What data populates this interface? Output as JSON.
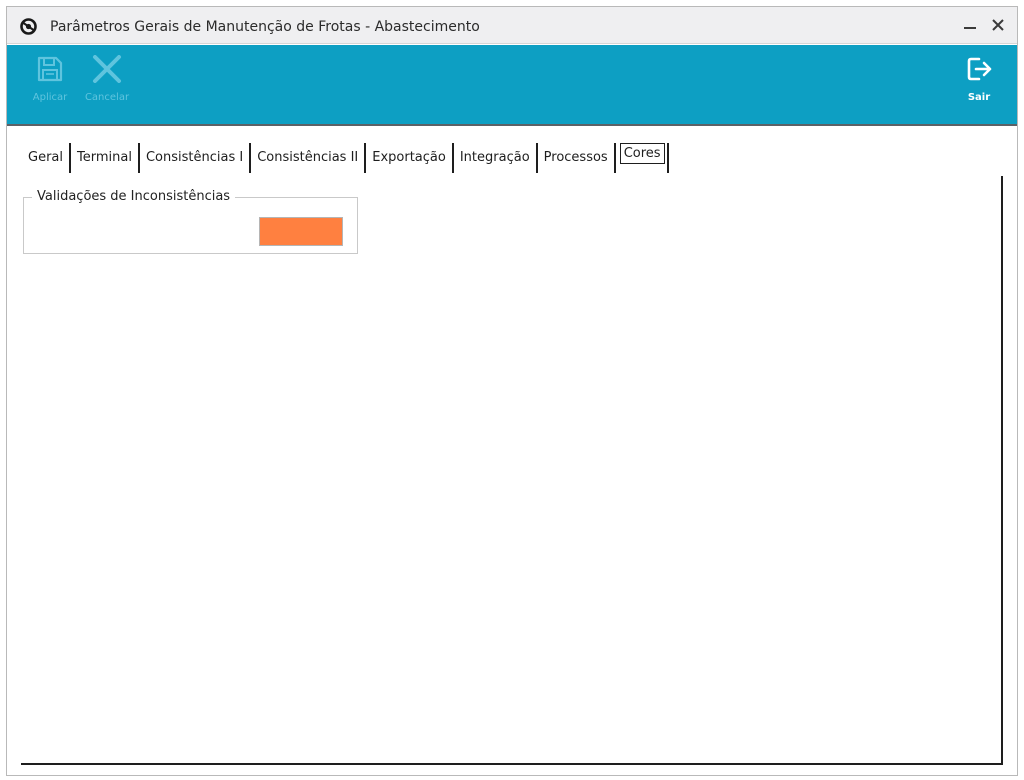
{
  "window": {
    "title": "Parâmetros Gerais de Manutenção de Frotas - Abastecimento"
  },
  "toolbar": {
    "apply_label": "Aplicar",
    "cancel_label": "Cancelar",
    "exit_label": "Sair"
  },
  "tabs": [
    {
      "label": "Geral"
    },
    {
      "label": "Terminal"
    },
    {
      "label": "Consistências I"
    },
    {
      "label": "Consistências II"
    },
    {
      "label": "Exportação"
    },
    {
      "label": "Integração"
    },
    {
      "label": "Processos"
    },
    {
      "label": "Cores"
    }
  ],
  "active_tab": "Cores",
  "colors_tab": {
    "group_title": "Validações de Inconsistências",
    "swatch_color": "#ff8040"
  },
  "theme": {
    "toolbar_color": "#0d9fc3",
    "disabled_text": "#5fc4de"
  }
}
